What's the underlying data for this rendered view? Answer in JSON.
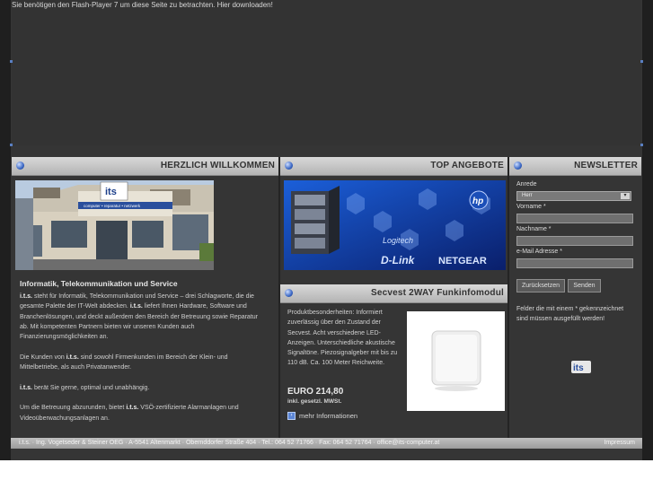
{
  "flash_notice": "Sie benötigen den Flash-Player 7 um diese Seite zu betrachten. Hier downloaden!",
  "welcome": {
    "header": "HERZLICH WILLKOMMEN",
    "image_sign_text": "its",
    "image_sign_sub": "computer • reparatur • netzwerk",
    "heading": "Informatik, Telekommunikation und Service",
    "p1_pre": "i.t.s.",
    "p1_a": " steht für Informatik, Telekommunikation und Service – drei Schlagworte, die die gesamte Palette der IT-Welt abdecken. ",
    "p1_b": "i.t.s.",
    "p1_c": " liefert Ihnen Hardware, Software und Branchenlösungen, und deckt außerdem den Bereich der Betreuung sowie Reparatur ab. Mit kompetenten Partnern bieten wir unseren Kunden auch Finanzierungsmöglichkeiten an.",
    "p2_a": "Die Kunden von ",
    "p2_b": "i.t.s.",
    "p2_c": " sind sowohl Firmenkunden im Bereich der Klein- und Mittelbetriebe, als auch Privatanwender.",
    "p3_a": "i.t.s.",
    "p3_b": " berät Sie gerne, optimal und unabhängig.",
    "p4_a": "Um die Betreuung abzurunden, bietet ",
    "p4_b": "i.t.s.",
    "p4_c": " VSÖ-zertifizierte Alarmanlagen und Videoüberwachungsanlagen an."
  },
  "top_offers": {
    "header": "TOP ANGEBOTE",
    "banner_brands": [
      "D-Link",
      "NETGEAR",
      "Logitech",
      "hp"
    ],
    "product_header": "Secvest 2WAY Funkinfomodul",
    "product_text": "Produktbesonderheiten: Informiert zuverlässig über den Zustand der Secvest. Acht verschiedene LED-Anzeigen. Unterschiedliche akustische Signaltöne. Piezosignalgeber mit bis zu 110 dB. Ca. 100 Meter Reichweite.",
    "price": "EURO 214,80",
    "price_note": "inkl. gesetzl. MWSt.",
    "more_link": "mehr Informationen"
  },
  "newsletter": {
    "header": "NEWSLETTER",
    "salutation_label": "Anrede",
    "salutation_value": "Herr",
    "firstname_label": "Vorname *",
    "lastname_label": "Nachname *",
    "email_label": "e-Mail Adresse *",
    "reset_button": "Zurücksetzen",
    "send_button": "Senden",
    "note": "Felder die mit einem * gekennzeichnet sind müssen ausgefüllt werden!",
    "logo_text": "its"
  },
  "footer": {
    "address": "i.t.s. · Ing. Vogetseder & Steiner OEG · A-5541 Altenmarkt · Obernddorfer Straße 404 · Tel.: 064 52 71766 · Fax: 064 52 71764 · office@its-computer.at",
    "impressum": "Impressum"
  }
}
